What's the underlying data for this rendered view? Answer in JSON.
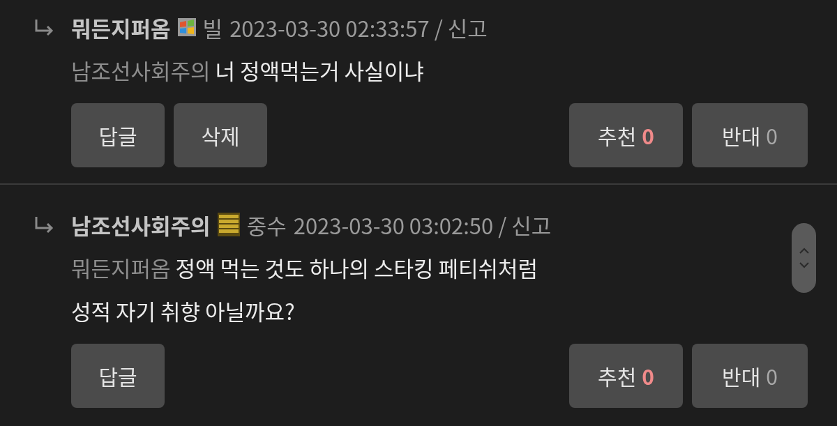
{
  "comments": [
    {
      "author": "뭐든지퍼옴",
      "badge": {
        "kind": "windows"
      },
      "level_label": "빌",
      "meta": "2023-03-30 02:33:57 / 신고",
      "mention": "남조선사회주의",
      "body_lines": [
        "너 정액먹는거 사실이냐"
      ],
      "actions": [
        {
          "label": "답글"
        },
        {
          "label": "삭제"
        }
      ],
      "votes": [
        {
          "kind": "up",
          "label": "추천",
          "count": "0"
        },
        {
          "kind": "down",
          "label": "반대",
          "count": "0"
        }
      ]
    },
    {
      "author": "남조선사회주의",
      "badge": {
        "kind": "bars"
      },
      "level_label": "중수",
      "meta": "2023-03-30 03:02:50 / 신고",
      "mention": "뭐든지퍼옴",
      "body_lines": [
        "정액 먹는 것도 하나의 스타킹 페티쉬처럼",
        "성적 자기 취향 아닐까요?"
      ],
      "actions": [
        {
          "label": "답글"
        }
      ],
      "votes": [
        {
          "kind": "up",
          "label": "추천",
          "count": "0"
        },
        {
          "kind": "down",
          "label": "반대",
          "count": "0"
        }
      ]
    }
  ]
}
